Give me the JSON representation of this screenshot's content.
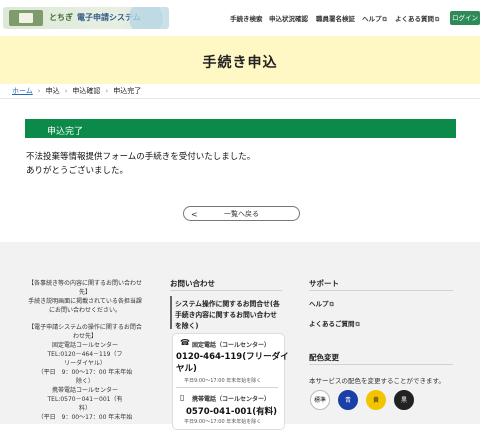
{
  "header": {
    "logo_text_1": "とちぎ",
    "logo_text_2": "電子申請システム",
    "nav": [
      {
        "label": "手続き検索"
      },
      {
        "label": "申込状況確認"
      },
      {
        "label": "職員署名検証"
      },
      {
        "label": "ヘルプ"
      },
      {
        "label": "よくある質問"
      }
    ],
    "login_label": "ログイン"
  },
  "page_title": "手続き申込",
  "breadcrumb": [
    "ホーム",
    "申込",
    "申込確認",
    "申込完了"
  ],
  "status": {
    "title": "申込完了",
    "message_1": "不法投棄等情報提供フォームの手続きを受付いたしました。",
    "message_2": "ありがとうございました。"
  },
  "back_button": {
    "chevron": "<",
    "label": "一覧へ戻る"
  },
  "footer": {
    "left_lines": [
      "【各事続き等の内容に関するお問い合わせ",
      "先】",
      "手続き説明画面に掲載されている各担当課",
      "にお問い合わせください。",
      "",
      "【電子申請システムの操作に関するお問合",
      "わせ先】",
      "固定電話コールセンター",
      "TEL:0120－464－119（フ",
      "リーダイヤル）",
      "（平日　9：00～17：00 年末年始",
      "除く）",
      "携帯電話コールセンター",
      "TEL:0570－041－001（有",
      "料）",
      "（平日　9：00～17：00 年末年始"
    ],
    "contact_heading": "お問い合わせ",
    "operation_line_1": "システム操作に関するお問合せ(各",
    "operation_line_2": "手続き内容に関するお問い合わせ",
    "operation_line_3": "を除く)",
    "landline_label": "固定電話（コールセンター）",
    "landline_number_1": "0120-464-119(フリーダイ",
    "landline_number_2": "ヤル)",
    "landline_hours": "平日9:00〜17:00 年末年始を除く",
    "mobile_label": "携帯電話（コールセンター）",
    "mobile_number": "0570-041-001(有料)",
    "mobile_hours": "平日9:00〜17:00 年末年始を除く",
    "support_heading": "サポート",
    "support_links": [
      {
        "label": "ヘルプ"
      },
      {
        "label": "よくあるご質問"
      }
    ],
    "color_heading": "配色変更",
    "color_text": "本サービスの配色を変更することができます。",
    "color_options": [
      {
        "label": "標準",
        "bg": "#ffffff",
        "fg": "#222222"
      },
      {
        "label": "青",
        "bg": "#1a3fa6",
        "fg": "#ffffff"
      },
      {
        "label": "黄",
        "bg": "#f3c400",
        "fg": "#222222"
      },
      {
        "label": "黒",
        "bg": "#222222",
        "fg": "#ffffff"
      }
    ]
  },
  "colors": {
    "accent_green": "#0b8a4a",
    "title_band": "#fff8c4",
    "link_blue": "#2a6bb0"
  }
}
